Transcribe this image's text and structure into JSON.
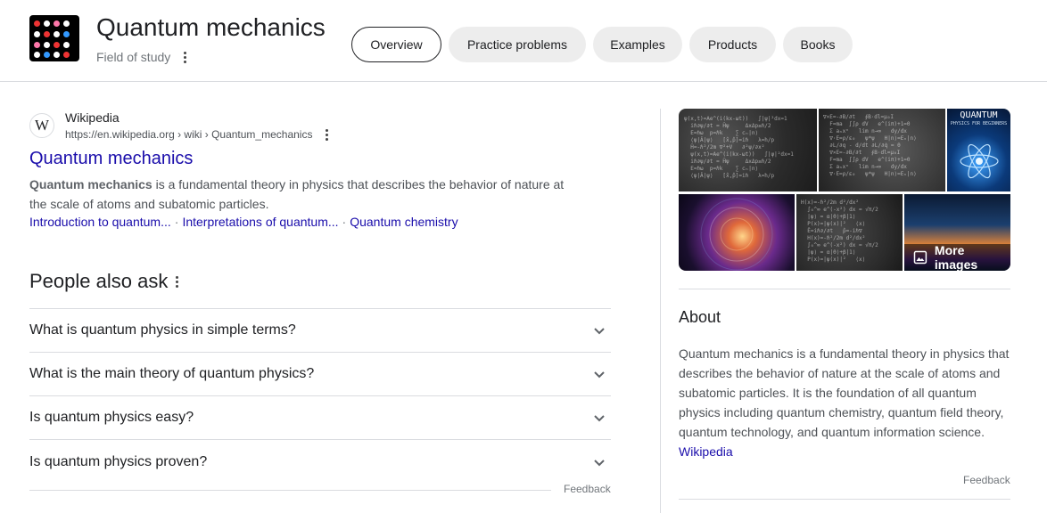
{
  "header": {
    "title": "Quantum mechanics",
    "subtitle": "Field of study",
    "tabs": [
      {
        "label": "Overview",
        "active": true
      },
      {
        "label": "Practice problems",
        "active": false
      },
      {
        "label": "Examples",
        "active": false
      },
      {
        "label": "Products",
        "active": false
      },
      {
        "label": "Books",
        "active": false
      }
    ]
  },
  "result": {
    "logo_letter": "W",
    "source_name": "Wikipedia",
    "source_url": "https://en.wikipedia.org › wiki › Quantum_mechanics",
    "title": "Quantum mechanics",
    "snippet_bold": "Quantum mechanics",
    "snippet_rest": " is a fundamental theory in physics that describes the behavior of nature at the scale of atoms and subatomic particles.",
    "sitelinks": [
      "Introduction to quantum...",
      "Interpretations of quantum...",
      "Quantum chemistry"
    ],
    "sitelink_separator": "·"
  },
  "people_also_ask": {
    "title": "People also ask",
    "questions": [
      "What is quantum physics in simple terms?",
      "What is the main theory of quantum physics?",
      "Is quantum physics easy?",
      "Is quantum physics proven?"
    ],
    "feedback": "Feedback"
  },
  "images": {
    "book_title": "QUANTUM",
    "book_subtitle": "PHYSICS FOR BEGINNERS",
    "more_images": "More images"
  },
  "about": {
    "title": "About",
    "text": "Quantum mechanics is a fundamental theory in physics that describes the behavior of nature at the scale of atoms and subatomic particles. It is the foundation of all quantum physics including quantum chemistry, quantum field theory, quantum technology, and quantum information science.",
    "link": "Wikipedia",
    "feedback": "Feedback"
  },
  "colors": {
    "link": "#1a0dab",
    "chip_bg": "#ededed",
    "divider": "#dadce0",
    "muted_text": "#70757a"
  }
}
